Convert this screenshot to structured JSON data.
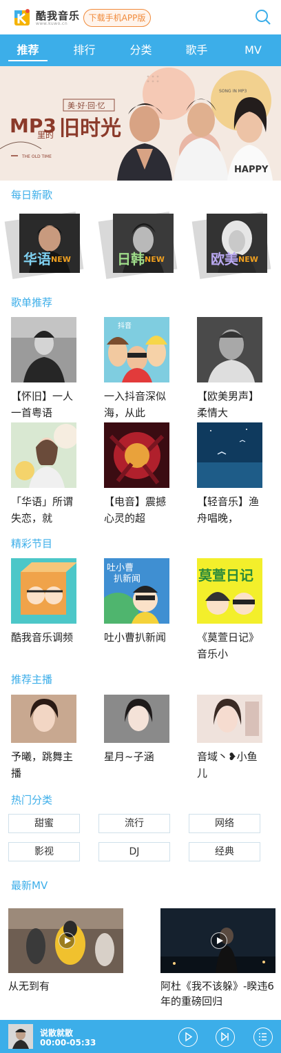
{
  "header": {
    "logo_text": "酷我音乐",
    "logo_domain": "www.kuwo.cn",
    "download_btn": "下载手机APP版"
  },
  "nav": {
    "tabs": [
      "推荐",
      "排行",
      "分类",
      "歌手",
      "MV"
    ]
  },
  "banner": {
    "tagline": "美·好·回·忆",
    "title_big": "MP3",
    "title_small": "里的",
    "title_main": "旧时光",
    "song_in": "SONG IN MP3",
    "old_time": "THE OLD TIME",
    "drawn_text": "HAPPY"
  },
  "sections": {
    "daily": "每日新歌",
    "playlists": "歌单推荐",
    "programs": "精彩节目",
    "anchors": "推荐主播",
    "categories": "热门分类",
    "mv": "最新MV"
  },
  "daily": [
    {
      "label": "华语",
      "badge": "NEW"
    },
    {
      "label": "日韩",
      "badge": "NEW"
    },
    {
      "label": "欧美",
      "badge": "NEW"
    }
  ],
  "playlists": [
    {
      "title": "【怀旧】一人一首粤语"
    },
    {
      "title": "一入抖音深似海，从此"
    },
    {
      "title": "【欧美男声】柔情大"
    },
    {
      "title": "「华语」所谓失恋，就"
    },
    {
      "title": "【电音】震撼心灵的超"
    },
    {
      "title": "【轻音乐】渔舟唱晚，"
    }
  ],
  "playlist_cover_text": {
    "douyin": "抖音"
  },
  "programs": [
    {
      "title": "酷我音乐调频"
    },
    {
      "title": "吐小曹扒新闻"
    },
    {
      "title": "《莫萱日记》音乐小"
    }
  ],
  "program_cover_text": {
    "p2_line1": "吐小曹",
    "p2_line2": "扒新闻",
    "p3": "莫萱日记"
  },
  "anchors": [
    {
      "name": "予曦，跳舞主播"
    },
    {
      "name": "星月~子涵"
    },
    {
      "name": "音域丶❥小鱼儿"
    }
  ],
  "categories": [
    "甜蜜",
    "流行",
    "网络",
    "影视",
    "DJ",
    "经典"
  ],
  "mvs": [
    {
      "title": "从无到有"
    },
    {
      "title": "阿杜《我不该躲》-睽违6年的重磅回归"
    }
  ],
  "player": {
    "song": "说散就散",
    "time": "00:00-05:33"
  },
  "colors": {
    "accent": "#3caee9",
    "download": "#f08a3a"
  }
}
